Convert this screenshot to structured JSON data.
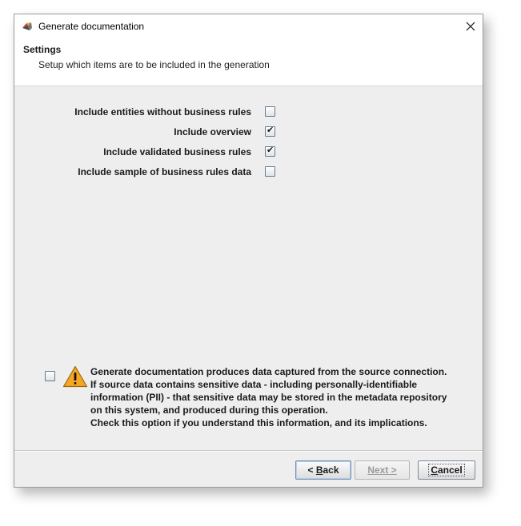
{
  "window": {
    "title": "Generate documentation"
  },
  "header": {
    "title": "Settings",
    "subtitle": "Setup which items are to be included in the generation"
  },
  "options": [
    {
      "label": "Include entities without business rules",
      "checked": false
    },
    {
      "label": "Include overview",
      "checked": true
    },
    {
      "label": "Include validated business rules",
      "checked": true
    },
    {
      "label": "Include sample of business rules data",
      "checked": false
    }
  ],
  "warning": {
    "checked": false,
    "icon": "warning-triangle-icon",
    "lines": [
      "Generate documentation produces data captured from the source connection.",
      "If source data contains sensitive data - including personally-identifiable",
      "information (PII) - that sensitive data may be stored in the metadata repository",
      "on this system, and produced during this operation.",
      "Check this option if you understand this information, and its implications."
    ]
  },
  "buttons": {
    "back_prefix": "< ",
    "back_mnemonic": "B",
    "back_rest": "ack",
    "next": "Next >",
    "cancel_mnemonic": "C",
    "cancel_rest": "ancel"
  },
  "colors": {
    "window_bg": "#eeeeee",
    "warning_fill": "#f5a623"
  }
}
